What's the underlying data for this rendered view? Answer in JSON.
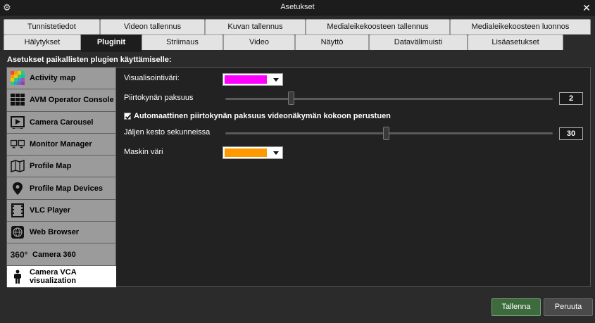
{
  "window": {
    "title": "Asetukset",
    "app_icon": "gears-icon",
    "close_label": "✕"
  },
  "tabs_row1": [
    {
      "label": "Tunnistetiedot"
    },
    {
      "label": "Videon tallennus"
    },
    {
      "label": "Kuvan tallennus"
    },
    {
      "label": "Medialeikekoosteen tallennus"
    },
    {
      "label": "Medialeikekoosteen luonnos"
    }
  ],
  "tabs_row2": [
    {
      "label": "Hälytykset"
    },
    {
      "label": "Pluginit",
      "active": true
    },
    {
      "label": "Striimaus"
    },
    {
      "label": "Video"
    },
    {
      "label": "Näyttö"
    },
    {
      "label": "Datavälimuisti"
    },
    {
      "label": "Lisäasetukset"
    }
  ],
  "section_label": "Asetukset paikallisten plugien käyttämiselle:",
  "plugins": [
    {
      "label": "Activity map",
      "icon": "activity-map-icon"
    },
    {
      "label": "AVM Operator Console",
      "icon": "grid-console-icon"
    },
    {
      "label": "Camera Carousel",
      "icon": "carousel-icon"
    },
    {
      "label": "Monitor Manager",
      "icon": "monitors-icon"
    },
    {
      "label": "Profile Map",
      "icon": "map-icon"
    },
    {
      "label": "Profile Map Devices",
      "icon": "map-pin-icon"
    },
    {
      "label": "VLC Player",
      "icon": "film-icon"
    },
    {
      "label": "Web Browser",
      "icon": "globe-icon"
    },
    {
      "label": "Camera 360",
      "icon": "camera-360-icon"
    },
    {
      "label": "Camera VCA visualization",
      "icon": "person-icon",
      "active": true
    }
  ],
  "settings": {
    "visualization_color_label": "Visualisointiväri:",
    "visualization_color": "#ff00ff",
    "pen_thickness_label": "Piirtokynän paksuus",
    "pen_thickness_value": "2",
    "pen_thickness_fraction": 0.2,
    "auto_thickness_label": "Automaattinen piirtokynän paksuus videonäkymän kokoon perustuen",
    "auto_thickness_checked": true,
    "trail_duration_label": "Jäljen kesto sekunneissa",
    "trail_duration_value": "30",
    "trail_duration_fraction": 0.49,
    "mask_color_label": "Maskin väri",
    "mask_color": "#ff9900"
  },
  "buttons": {
    "save_label": "Tallenna",
    "cancel_label": "Peruuta"
  }
}
